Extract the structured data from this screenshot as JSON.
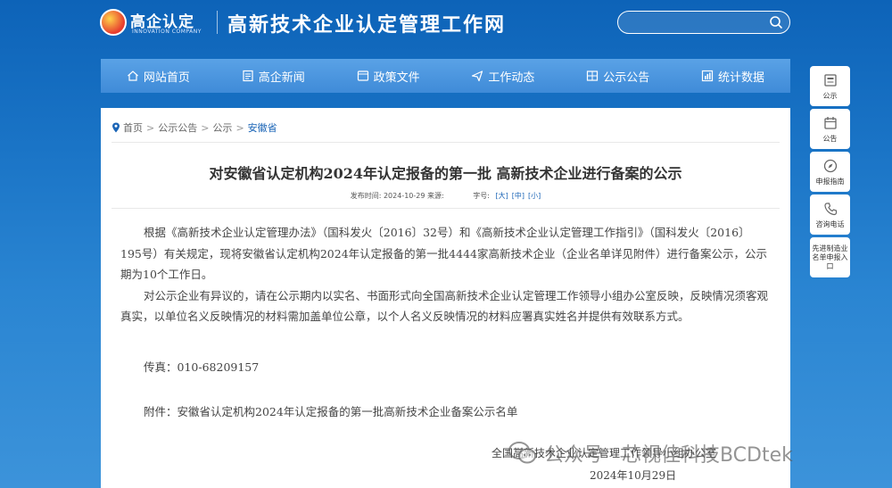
{
  "header": {
    "logo_cn": "高企认定",
    "logo_en": "INNOVATION COMPANY",
    "site_title": "高新技术企业认定管理工作网",
    "search_placeholder": ""
  },
  "nav": [
    {
      "label": "网站首页",
      "icon": "home-icon"
    },
    {
      "label": "高企新闻",
      "icon": "news-icon"
    },
    {
      "label": "政策文件",
      "icon": "document-icon"
    },
    {
      "label": "工作动态",
      "icon": "send-icon"
    },
    {
      "label": "公示公告",
      "icon": "announcement-icon"
    },
    {
      "label": "统计数据",
      "icon": "stats-icon"
    }
  ],
  "float_bar": [
    {
      "label": "公示",
      "icon": "notice-icon"
    },
    {
      "label": "公告",
      "icon": "calendar-icon"
    },
    {
      "label": "申报指南",
      "icon": "compass-icon"
    },
    {
      "label": "咨询电话",
      "icon": "phone-icon"
    },
    {
      "label": "先进制造业名单申报入口",
      "icon": ""
    }
  ],
  "breadcrumb": {
    "items": [
      "首页",
      "公示公告",
      "公示"
    ],
    "current": "安徽省",
    "separator": ">"
  },
  "article": {
    "title": "对安徽省认定机构2024年认定报备的第一批 高新技术企业进行备案的公示",
    "meta_date_label": "发布时间: 2024-10-29 来源:",
    "meta_size_label": "字号:",
    "size_large": "[大]",
    "size_medium": "[中]",
    "size_small": "[小]",
    "paragraph1": "根据《高新技术企业认定管理办法》（国科发火〔2016〕32号）和《高新技术企业认定管理工作指引》（国科发火〔2016〕195号）有关规定，现将安徽省认定机构2024年认定报备的第一批4444家高新技术企业（企业名单详见附件）进行备案公示，公示期为10个工作日。",
    "paragraph2": "对公示企业有异议的，请在公示期内以实名、书面形式向全国高新技术企业认定管理工作领导小组办公室反映，反映情况须客观真实，以单位名义反映情况的材料需加盖单位公章，以个人名义反映情况的材料应署真实姓名并提供有效联系方式。",
    "fax": "传真：010-68209157",
    "attachment": "附件：安徽省认定机构2024年认定报备的第一批高新技术企业备案公示名单",
    "sign_org": "全国高新技术企业认定管理工作领导小组办公室",
    "sign_date": "2024年10月29日"
  },
  "watermark": {
    "text": "公众号 · 芯视佳科技BCDtek"
  },
  "colors": {
    "nav_bg": "#4a95de",
    "link": "#1a64b6",
    "text": "#444444"
  }
}
